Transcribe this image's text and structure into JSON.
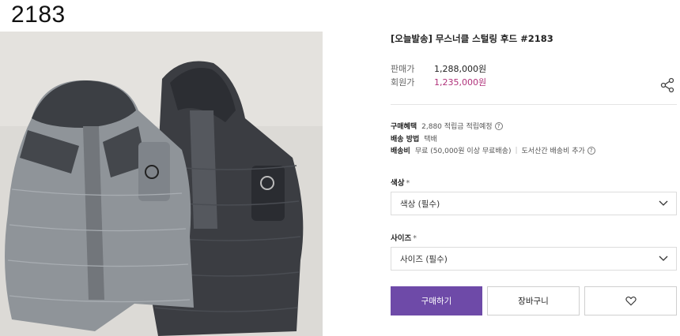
{
  "code_title": "2183",
  "product": {
    "name": "[오늘발송] 무스너클 스털링 후드 #2183",
    "sale_label": "판매가",
    "sale_price": "1,288,000원",
    "member_label": "회원가",
    "member_price": "1,235,000원"
  },
  "benefits": {
    "purchase_label": "구매혜택",
    "purchase_value": "2,880 적립금 적립예정",
    "shipping_method_label": "배송 방법",
    "shipping_method_value": "택배",
    "shipping_fee_label": "배송비",
    "shipping_fee_value": "무료 (50,000원 이상 무료배송)",
    "shipping_fee_extra": "도서산간 배송비 추가"
  },
  "options": {
    "color_label": "색상",
    "color_placeholder": "색상 (필수)",
    "size_label": "사이즈",
    "size_placeholder": "사이즈 (필수)",
    "required_mark": "*"
  },
  "actions": {
    "buy_label": "구매하기",
    "cart_label": "장바구니"
  },
  "icons": {
    "share": "share-icon",
    "wishlist": "heart-icon",
    "dropdown": "chevron-down-icon",
    "help": "question-icon"
  },
  "colors": {
    "buy_button": "#6e4aa8",
    "member_price": "#b0317a"
  }
}
